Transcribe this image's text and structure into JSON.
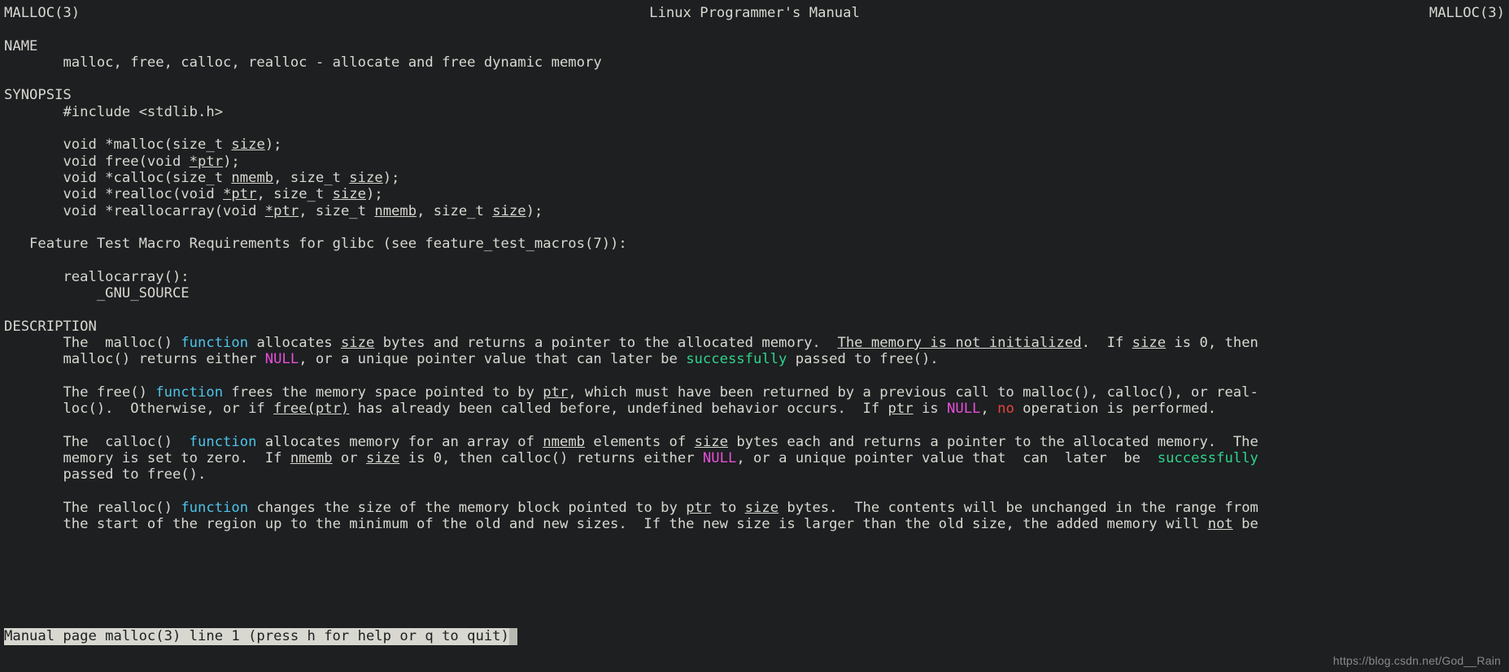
{
  "window": {
    "background_color": "#1d1f21",
    "foreground_color": "#d8d8d0"
  },
  "palette": {
    "cyan": "#4fc3e8",
    "magenta": "#e84fd8",
    "green": "#2fd48a",
    "red": "#e8453c",
    "status_bg": "#d8d8d0",
    "status_fg": "#1d1f21"
  },
  "header": {
    "left": "MALLOC(3)",
    "center": "Linux Programmer's Manual",
    "right": "MALLOC(3)"
  },
  "sections": {
    "name": {
      "heading": "NAME",
      "body": "malloc, free, calloc, realloc - allocate and free dynamic memory"
    },
    "synopsis": {
      "heading": "SYNOPSIS",
      "include": "#include <stdlib.h>",
      "prototypes": [
        {
          "pre": "void *malloc(size_t ",
          "arg1": "size",
          "post": ");"
        },
        {
          "pre": "void free(void ",
          "arg1": "*ptr",
          "post": ");"
        },
        {
          "pre": "void *calloc(size_t ",
          "arg1": "nmemb",
          "mid": ", size_t ",
          "arg2": "size",
          "post": ");"
        },
        {
          "pre": "void *realloc(void ",
          "arg1": "*ptr",
          "mid": ", size_t ",
          "arg2": "size",
          "post": ");"
        },
        {
          "pre": "void *reallocarray(void ",
          "arg1": "*ptr",
          "mid": ", size_t ",
          "arg2": "nmemb",
          "mid2": ", size_t ",
          "arg3": "size",
          "post": ");"
        }
      ],
      "feature_test_heading": "Feature Test Macro Requirements for glibc (see feature_test_macros(7)):",
      "feature_func": "reallocarray():",
      "feature_macro": "_GNU_SOURCE"
    },
    "description": {
      "heading": "DESCRIPTION",
      "paragraphs": [
        {
          "lines": [
            [
              {
                "t": "The  malloc() ",
                "s": "plain"
              },
              {
                "t": "function",
                "s": "cyan"
              },
              {
                "t": " allocates ",
                "s": "plain"
              },
              {
                "t": "size",
                "s": "underline"
              },
              {
                "t": " bytes and returns a pointer to the allocated memory.  ",
                "s": "plain"
              },
              {
                "t": "The memory is not initialized",
                "s": "underline"
              },
              {
                "t": ".  If ",
                "s": "plain"
              },
              {
                "t": "size",
                "s": "underline"
              },
              {
                "t": " is 0, then",
                "s": "plain"
              }
            ],
            [
              {
                "t": "malloc() returns either ",
                "s": "plain"
              },
              {
                "t": "NULL",
                "s": "magenta"
              },
              {
                "t": ", or a unique pointer value that can later be ",
                "s": "plain"
              },
              {
                "t": "successfully",
                "s": "green"
              },
              {
                "t": " passed to free().",
                "s": "plain"
              }
            ]
          ]
        },
        {
          "lines": [
            [
              {
                "t": "The free() ",
                "s": "plain"
              },
              {
                "t": "function",
                "s": "cyan"
              },
              {
                "t": " frees the memory space pointed to by ",
                "s": "plain"
              },
              {
                "t": "ptr",
                "s": "underline"
              },
              {
                "t": ", which must have been returned by a previous call to malloc(), calloc(), or real-",
                "s": "plain"
              }
            ],
            [
              {
                "t": "loc().  Otherwise, or if ",
                "s": "plain"
              },
              {
                "t": "free(ptr)",
                "s": "underline"
              },
              {
                "t": " has already been called before, undefined behavior occurs.  If ",
                "s": "plain"
              },
              {
                "t": "ptr",
                "s": "underline"
              },
              {
                "t": " is ",
                "s": "plain"
              },
              {
                "t": "NULL",
                "s": "magenta"
              },
              {
                "t": ", ",
                "s": "plain"
              },
              {
                "t": "no",
                "s": "red"
              },
              {
                "t": " operation is performed.",
                "s": "plain"
              }
            ]
          ]
        },
        {
          "lines": [
            [
              {
                "t": "The  calloc()  ",
                "s": "plain"
              },
              {
                "t": "function",
                "s": "cyan"
              },
              {
                "t": " allocates memory for an array of ",
                "s": "plain"
              },
              {
                "t": "nmemb",
                "s": "underline"
              },
              {
                "t": " elements of ",
                "s": "plain"
              },
              {
                "t": "size",
                "s": "underline"
              },
              {
                "t": " bytes each and returns a pointer to the allocated memory.  The",
                "s": "plain"
              }
            ],
            [
              {
                "t": "memory is set to zero.  If ",
                "s": "plain"
              },
              {
                "t": "nmemb",
                "s": "underline"
              },
              {
                "t": " or ",
                "s": "plain"
              },
              {
                "t": "size",
                "s": "underline"
              },
              {
                "t": " is 0, then calloc() returns either ",
                "s": "plain"
              },
              {
                "t": "NULL",
                "s": "magenta"
              },
              {
                "t": ", or a unique pointer value that  can  later  be  ",
                "s": "plain"
              },
              {
                "t": "successfully",
                "s": "green"
              }
            ],
            [
              {
                "t": "passed to free().",
                "s": "plain"
              }
            ]
          ]
        },
        {
          "lines": [
            [
              {
                "t": "The realloc() ",
                "s": "plain"
              },
              {
                "t": "function",
                "s": "cyan"
              },
              {
                "t": " changes the size of the memory block pointed to by ",
                "s": "plain"
              },
              {
                "t": "ptr",
                "s": "underline"
              },
              {
                "t": " to ",
                "s": "plain"
              },
              {
                "t": "size",
                "s": "underline"
              },
              {
                "t": " bytes.  The contents will be unchanged in the range from",
                "s": "plain"
              }
            ],
            [
              {
                "t": "the start of the region up to the minimum of the old and new sizes.  If the new size is larger than the old size, the added memory will ",
                "s": "plain"
              },
              {
                "t": "not",
                "s": "underline"
              },
              {
                "t": " be",
                "s": "plain"
              }
            ]
          ]
        }
      ]
    }
  },
  "status_bar": {
    "text": "Manual page malloc(3) line 1 (press h for help or q to quit)",
    "cursor": " "
  },
  "watermark": "https://blog.csdn.net/God__Rain"
}
